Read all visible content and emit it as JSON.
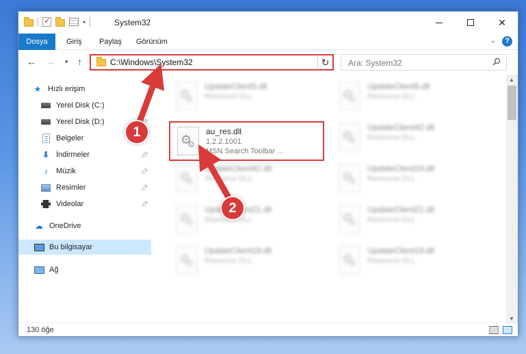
{
  "window": {
    "title": "System32",
    "buttons": {
      "minimize": "minimize",
      "maximize": "maximize",
      "close": "✕"
    }
  },
  "ribbon": {
    "tabs": [
      "Dosya",
      "Giriş",
      "Paylaş",
      "Görünüm"
    ],
    "help": "?"
  },
  "nav": {
    "back": "←",
    "forward": "→",
    "recent": "▾",
    "up": "↑",
    "address": "C:\\Windows\\System32",
    "refresh": "↻",
    "search_placeholder": "Ara: System32"
  },
  "sidebar": {
    "items": [
      {
        "label": "Hızlı erişim",
        "icon": "star-icon",
        "pinned": false
      },
      {
        "label": "Yerel Disk (C:)",
        "icon": "drive-icon",
        "pinned": false
      },
      {
        "label": "Yerel Disk (D:)",
        "icon": "drive-icon",
        "pinned": true
      },
      {
        "label": "Belgeler",
        "icon": "documents-icon",
        "pinned": true
      },
      {
        "label": "İndirmeler",
        "icon": "downloads-icon",
        "pinned": true
      },
      {
        "label": "Müzik",
        "icon": "music-icon",
        "pinned": true
      },
      {
        "label": "Resimler",
        "icon": "pictures-icon",
        "pinned": true
      },
      {
        "label": "Videolar",
        "icon": "videos-icon",
        "pinned": true
      },
      {
        "label": "OneDrive",
        "icon": "onedrive-icon",
        "pinned": false
      },
      {
        "label": "Bu bilgisayar",
        "icon": "this-pc-icon",
        "pinned": false,
        "selected": true
      },
      {
        "label": "Ağ",
        "icon": "network-icon",
        "pinned": false
      }
    ]
  },
  "files": [
    {
      "name": "UpdateClient5.dll",
      "desc1": "Resource DLL",
      "desc2": "",
      "blurred": true
    },
    {
      "name": "UpdateClient5.dll",
      "desc1": "Resource DLL",
      "desc2": "",
      "blurred": true
    },
    {
      "name": "au_res.dll",
      "desc1": "1.2.2.1001",
      "desc2": "MSN Search Toolbar ...",
      "blurred": false
    },
    {
      "name": "UpdateClient42.dll",
      "desc1": "Resource DLL",
      "desc2": "",
      "blurred": true
    },
    {
      "name": "UpdateClient42.dll",
      "desc1": "Resource DLL",
      "desc2": "",
      "blurred": true
    },
    {
      "name": "UpdateClient19.dll",
      "desc1": "Resource DLL",
      "desc2": "",
      "blurred": true
    },
    {
      "name": "UpdateClient21.dll",
      "desc1": "Resource DLL",
      "desc2": "",
      "blurred": true
    },
    {
      "name": "UpdateClient21.dll",
      "desc1": "Resource DLL",
      "desc2": "",
      "blurred": true
    },
    {
      "name": "UpdateClient19.dll",
      "desc1": "Resource DLL",
      "desc2": "",
      "blurred": true
    },
    {
      "name": "UpdateClient19.dll",
      "desc1": "Resource DLL",
      "desc2": "",
      "blurred": true
    }
  ],
  "status": {
    "count": "130 öğe"
  },
  "annotations": {
    "step1": "1",
    "step2": "2",
    "color": "#d93a3a"
  }
}
